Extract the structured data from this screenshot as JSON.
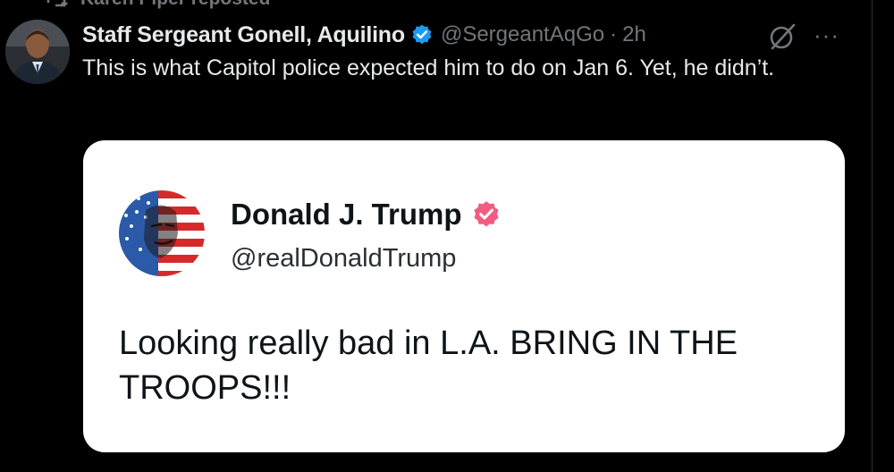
{
  "repost": {
    "label": "Karen Piper reposted",
    "icon": "repost-icon"
  },
  "tweet": {
    "author_name": "Staff Sergeant Gonell, Aquilino",
    "handle": "@SergeantAqGo",
    "separator": "·",
    "time": "2h",
    "text": "This is what Capitol police expected him to do on Jan 6. Yet, he didn’t.",
    "more_label": "···",
    "verified_color": "#1d9bf0"
  },
  "quoted_card": {
    "name": "Donald J. Trump",
    "handle": "@realDonaldTrump",
    "text": "Looking really bad in L.A. BRING IN THE TROOPS!!!",
    "badge_color": "#f25c80"
  },
  "colors": {
    "background": "#000000",
    "text_primary": "#e7e9ea",
    "text_secondary": "#71767b",
    "card_background": "#ffffff"
  }
}
